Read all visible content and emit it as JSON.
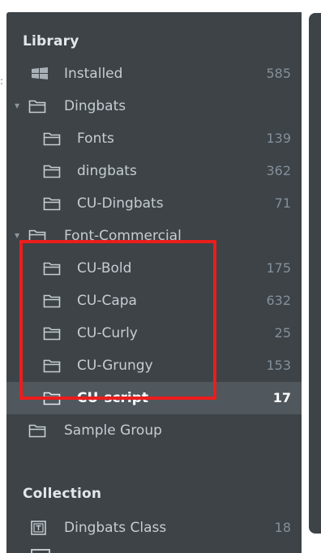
{
  "library": {
    "title": "Library",
    "items": [
      {
        "label": "Installed",
        "count": "585",
        "icon": "windows-icon"
      },
      {
        "label": "Dingbats",
        "count": "",
        "icon": "folder-icon",
        "expanded": true
      },
      {
        "label": "Fonts",
        "count": "139",
        "icon": "folder-icon"
      },
      {
        "label": "dingbats",
        "count": "362",
        "icon": "folder-icon"
      },
      {
        "label": "CU-Dingbats",
        "count": "71",
        "icon": "folder-icon"
      },
      {
        "label": "Font-Commercial",
        "count": "",
        "icon": "folder-icon",
        "expanded": true
      },
      {
        "label": "CU-Bold",
        "count": "175",
        "icon": "folder-icon"
      },
      {
        "label": "CU-Capa",
        "count": "632",
        "icon": "folder-icon"
      },
      {
        "label": "CU-Curly",
        "count": "25",
        "icon": "folder-icon"
      },
      {
        "label": "CU-Grungy",
        "count": "153",
        "icon": "folder-icon"
      },
      {
        "label": "CU-script",
        "count": "17",
        "icon": "folder-icon",
        "selected": true
      },
      {
        "label": "Sample Group",
        "count": "",
        "icon": "folder-icon"
      }
    ]
  },
  "collection": {
    "title": "Collection",
    "items": [
      {
        "label": "Dingbats Class",
        "count": "18",
        "icon": "font-class-icon"
      }
    ]
  },
  "colors": {
    "panel_bg": "#3d4347",
    "selected_bg": "#50575d",
    "highlight": "#ec1d1d",
    "label": "#c6cdd2",
    "count": "#85909a"
  }
}
